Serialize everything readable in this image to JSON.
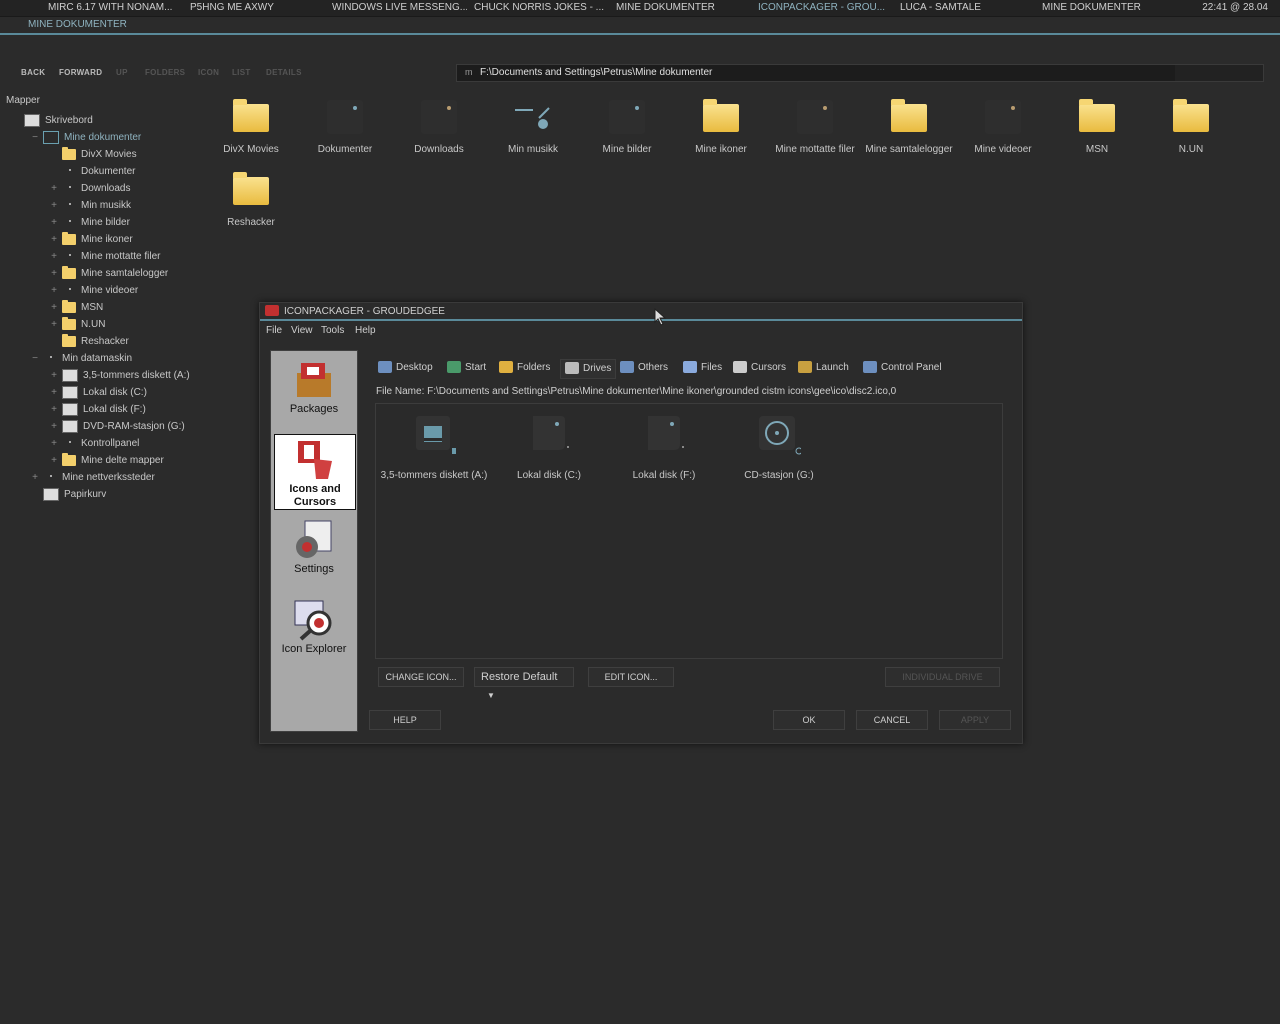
{
  "taskbar": {
    "tasks": [
      {
        "label": "MIRC 6.17 WITH NONAM...",
        "active": false
      },
      {
        "label": "P5HNG ME AXWY",
        "active": false
      },
      {
        "label": "WINDOWS LIVE MESSENG...",
        "active": false
      },
      {
        "label": "CHUCK NORRIS JOKES - ...",
        "active": false
      },
      {
        "label": "MINE DOKUMENTER",
        "active": false
      },
      {
        "label": "ICONPACKAGER - GROU...",
        "active": true
      },
      {
        "label": "LUCA - SAMTALE",
        "active": false
      },
      {
        "label": "MINE DOKUMENTER",
        "active": false
      }
    ],
    "clock": "22:41  @  28.04"
  },
  "explorer": {
    "title": "MINE DOKUMENTER",
    "toolbar": {
      "back": "BACK",
      "forward": "FORWARD",
      "up": "UP",
      "folders": "FOLDERS",
      "icon": "ICON",
      "list": "LIST",
      "details": "DETAILS"
    },
    "address": "F:\\Documents and Settings\\Petrus\\Mine dokumenter",
    "tree_title": "Mapper",
    "tree": [
      {
        "label": "Skrivebord",
        "level": 0,
        "exp": "",
        "icon": "desktop-icon"
      },
      {
        "label": "Mine dokumenter",
        "level": 1,
        "exp": "−",
        "icon": "documents-icon",
        "selected": true
      },
      {
        "label": "DivX Movies",
        "level": 2,
        "exp": "",
        "icon": "folder-icon"
      },
      {
        "label": "Dokumenter",
        "level": 2,
        "exp": "",
        "icon": "dot-icon"
      },
      {
        "label": "Downloads",
        "level": 2,
        "exp": "+",
        "icon": "dot-icon"
      },
      {
        "label": "Min musikk",
        "level": 2,
        "exp": "+",
        "icon": "music-icon"
      },
      {
        "label": "Mine bilder",
        "level": 2,
        "exp": "+",
        "icon": "dot-icon"
      },
      {
        "label": "Mine ikoner",
        "level": 2,
        "exp": "+",
        "icon": "folder-icon"
      },
      {
        "label": "Mine mottatte filer",
        "level": 2,
        "exp": "+",
        "icon": "dot-icon"
      },
      {
        "label": "Mine samtalelogger",
        "level": 2,
        "exp": "+",
        "icon": "folder-icon"
      },
      {
        "label": "Mine videoer",
        "level": 2,
        "exp": "+",
        "icon": "dot-icon"
      },
      {
        "label": "MSN",
        "level": 2,
        "exp": "+",
        "icon": "folder-icon"
      },
      {
        "label": "N.UN",
        "level": 2,
        "exp": "+",
        "icon": "folder-icon"
      },
      {
        "label": "Reshacker",
        "level": 2,
        "exp": "",
        "icon": "folder-icon"
      },
      {
        "label": "Min datamaskin",
        "level": 1,
        "exp": "−",
        "icon": "computer-icon"
      },
      {
        "label": "3,5-tommers diskett (A:)",
        "level": 2,
        "exp": "+",
        "icon": "floppy-icon"
      },
      {
        "label": "Lokal disk (C:)",
        "level": 2,
        "exp": "+",
        "icon": "drive-icon"
      },
      {
        "label": "Lokal disk (F:)",
        "level": 2,
        "exp": "+",
        "icon": "drive-icon"
      },
      {
        "label": "DVD-RAM-stasjon (G:)",
        "level": 2,
        "exp": "+",
        "icon": "dvd-icon"
      },
      {
        "label": "Kontrollpanel",
        "level": 2,
        "exp": "+",
        "icon": "control-panel-icon"
      },
      {
        "label": "Mine delte mapper",
        "level": 2,
        "exp": "+",
        "icon": "shared-folder-icon"
      },
      {
        "label": "Mine nettverkssteder",
        "level": 1,
        "exp": "+",
        "icon": "network-icon"
      },
      {
        "label": "Papirkurv",
        "level": 1,
        "exp": "",
        "icon": "recycle-bin-icon"
      }
    ],
    "items": [
      {
        "label": "DivX Movies",
        "type": "folder"
      },
      {
        "label": "Dokumenter",
        "type": "tile"
      },
      {
        "label": "Downloads",
        "type": "tile-y"
      },
      {
        "label": "Min musikk",
        "type": "music"
      },
      {
        "label": "Mine bilder",
        "type": "tile"
      },
      {
        "label": "Mine ikoner",
        "type": "folder"
      },
      {
        "label": "Mine mottatte filer",
        "type": "tile-y"
      },
      {
        "label": "Mine samtalelogger",
        "type": "folder"
      },
      {
        "label": "Mine videoer",
        "type": "tile-y"
      },
      {
        "label": "MSN",
        "type": "folder"
      },
      {
        "label": "N.UN",
        "type": "folder"
      },
      {
        "label": "Reshacker",
        "type": "folder"
      }
    ]
  },
  "dialog": {
    "title": "ICONPACKAGER - GROUDEDGEE",
    "menu": [
      "File",
      "View",
      "Tools",
      "Help"
    ],
    "sidebar": [
      {
        "label": "Packages",
        "selected": false
      },
      {
        "label": "Icons and Cursors",
        "selected": true
      },
      {
        "label": "Settings",
        "selected": false
      },
      {
        "label": "Icon Explorer",
        "selected": false
      }
    ],
    "tabs": [
      {
        "label": "Desktop",
        "active": false
      },
      {
        "label": "Start",
        "active": false
      },
      {
        "label": "Folders",
        "active": false
      },
      {
        "label": "Drives",
        "active": true
      },
      {
        "label": "Others",
        "active": false
      },
      {
        "label": "Files",
        "active": false
      },
      {
        "label": "Cursors",
        "active": false
      },
      {
        "label": "Launch",
        "active": false
      },
      {
        "label": "Control Panel",
        "active": false
      }
    ],
    "filename": "File Name: F:\\Documents and Settings\\Petrus\\Mine dokumenter\\Mine ikoner\\grounded cistm icons\\gee\\ico\\disc2.ico,0",
    "drives": [
      {
        "label": "3,5-tommers diskett (A:)",
        "type": "floppy"
      },
      {
        "label": "Lokal disk (C:)",
        "type": "disk"
      },
      {
        "label": "Lokal disk (F:)",
        "type": "disk"
      },
      {
        "label": "CD-stasjon (G:)",
        "type": "cd"
      }
    ],
    "buttons": {
      "change_icon": "CHANGE ICON...",
      "restore_default": "Restore Default",
      "edit_icon": "EDIT ICON...",
      "individual_drive": "INDIVIDUAL DRIVE",
      "help": "HELP",
      "ok": "OK",
      "cancel": "CANCEL",
      "apply": "APPLY"
    }
  }
}
